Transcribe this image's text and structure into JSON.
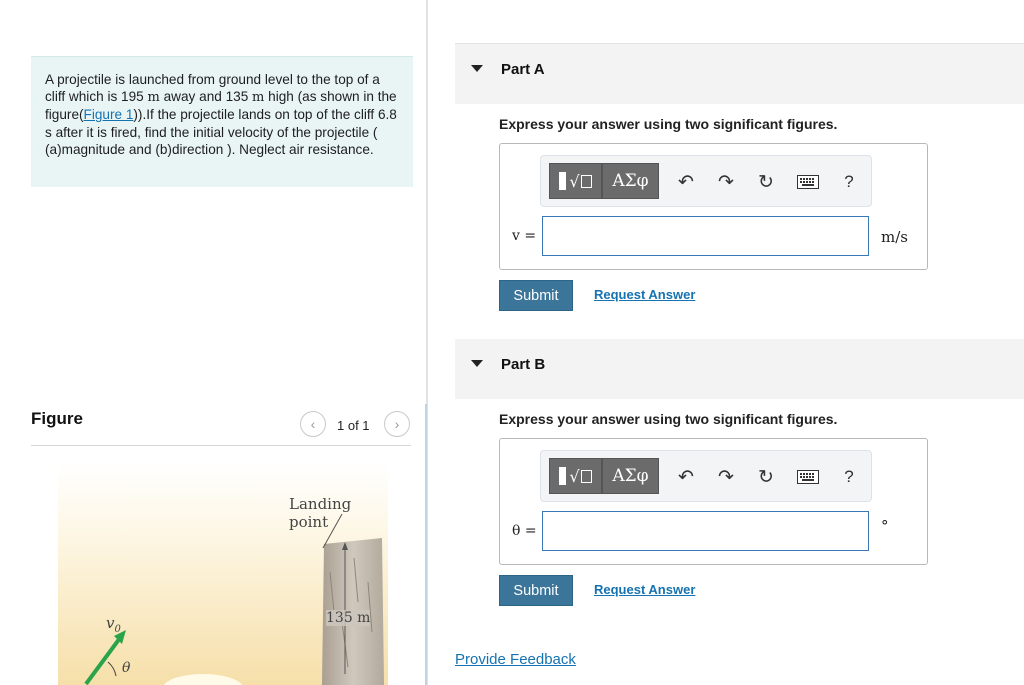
{
  "problem": {
    "text_1": "A projectile is launched from ground level to the top of a cliff which is 195 ",
    "unit_m1": "m",
    "text_2": " away and 135 ",
    "unit_m2": "m",
    "text_3": " high (as shown in the figure(",
    "figure_link": "Figure 1",
    "text_4": ")).If the projectile lands on top of the cliff 6.8 s after it is fired, find the initial velocity of the projectile ( (a)magnitude and (b)direction ). Neglect air resistance."
  },
  "figure": {
    "title": "Figure",
    "pager_prev": "‹",
    "pager_next": "›",
    "pager_count": "1 of 1",
    "labels": {
      "landing_point": "Landing point",
      "height": "135 m",
      "v0": "v",
      "v0_sub": "0",
      "theta": "θ"
    }
  },
  "part_a": {
    "title": "Part A",
    "instructions": "Express your answer using two significant figures.",
    "toolbar": {
      "symbols": "ΑΣφ",
      "undo": "↶",
      "redo": "↷",
      "reset": "↻",
      "help": "?"
    },
    "variable_label": "v =",
    "input_value": "",
    "unit": "m/s",
    "submit": "Submit",
    "request_answer": "Request Answer"
  },
  "part_b": {
    "title": "Part B",
    "instructions": "Express your answer using two significant figures.",
    "toolbar": {
      "symbols": "ΑΣφ",
      "undo": "↶",
      "redo": "↷",
      "reset": "↻",
      "help": "?"
    },
    "variable_label": "θ =",
    "input_value": "",
    "unit": "°",
    "submit": "Submit",
    "request_answer": "Request Answer"
  },
  "feedback": "Provide Feedback",
  "colors": {
    "link": "#1673b1",
    "submit_bg": "#3b7599",
    "problem_bg": "#e9f5f5",
    "input_border": "#3a77b7"
  }
}
